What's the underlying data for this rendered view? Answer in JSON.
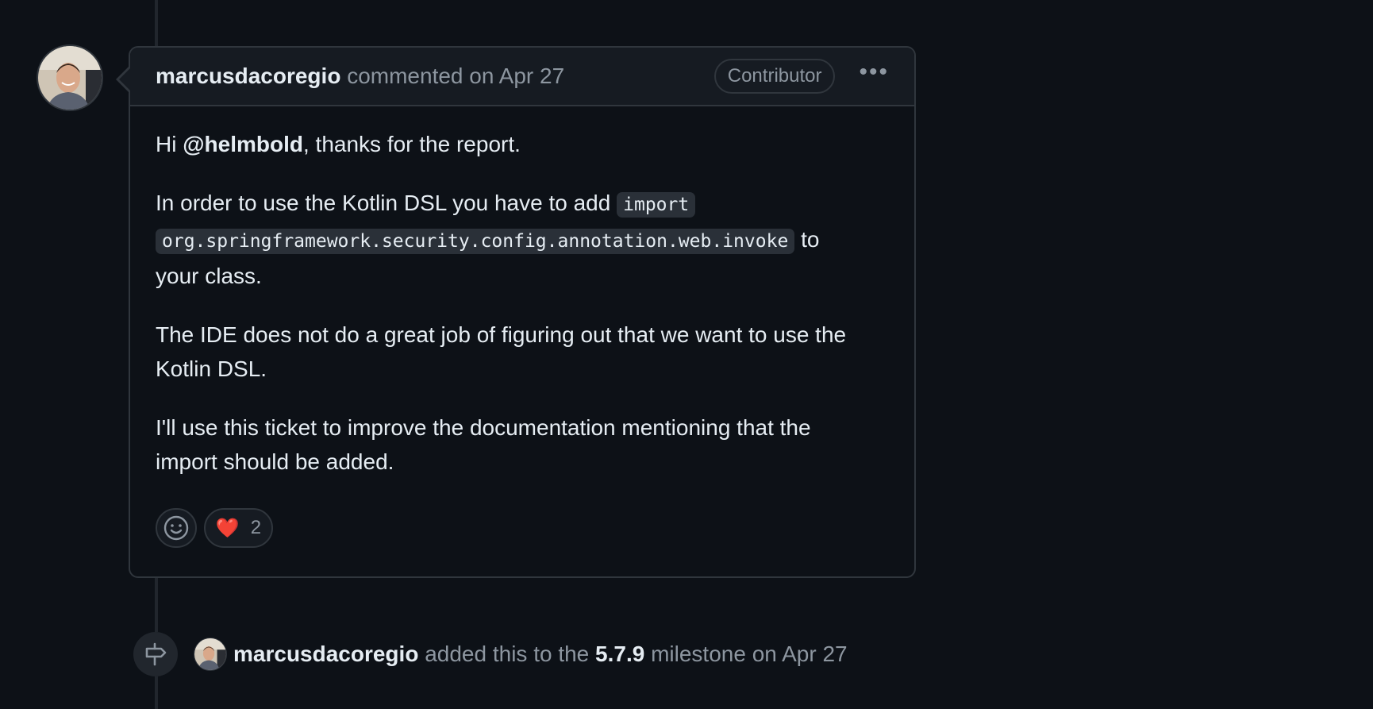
{
  "comment": {
    "author": "marcusdacoregio",
    "action": "commented on Apr 27",
    "badge": "Contributor",
    "menu_label": "•••",
    "body": {
      "p1_prefix": "Hi ",
      "p1_mention": "@helmbold",
      "p1_suffix": ", thanks for the report.",
      "p2_prefix": "In order to use the Kotlin DSL you have to add",
      "p2_code_line1": "import",
      "p2_code_line2": "org.springframework.security.config.annotation.web.invoke",
      "p2_suffix_to": "to",
      "p2_suffix_rest": "your class.",
      "p3_line1": "The IDE does not do a great job of figuring out that we want to use the",
      "p3_line2": "Kotlin DSL.",
      "p4_line1": "I'll use this ticket to improve the documentation mentioning that the",
      "p4_line2": "import should be added."
    },
    "reactions": {
      "heart_emoji": "❤️",
      "heart_count": "2"
    }
  },
  "event": {
    "author": "marcusdacoregio",
    "text_before": "added this to the",
    "milestone": "5.7.9",
    "text_after": "milestone on Apr 27"
  },
  "icons": {
    "avatar": "user-avatar",
    "emoji_picker": "smiley-icon",
    "milestone": "milestone-icon",
    "menu": "kebab-horizontal-icon"
  },
  "colors": {
    "background": "#0d1117",
    "header_bg": "#161b22",
    "border": "#30363d",
    "text": "#e6edf3",
    "muted": "#8d96a0",
    "code_bg": "#2a3038",
    "heart": "#f85149"
  }
}
